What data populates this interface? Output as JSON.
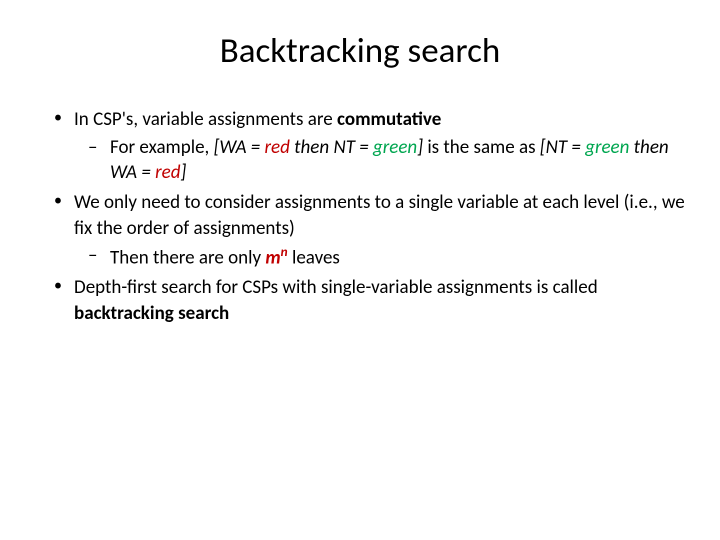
{
  "title": "Backtracking search",
  "b1_pre": "In CSP's, variable assignments are ",
  "b1_bold": "commutative",
  "b1a_pre": "For example, ",
  "b1a_i1": "[WA = ",
  "b1a_red1": "red",
  "b1a_i2": " then NT = ",
  "b1a_green1": "green",
  "b1a_i3": "]",
  "b1a_mid": " is the same as ",
  "b1a_i4": "[NT = ",
  "b1a_green2": "green",
  "b1a_i5": " then WA = ",
  "b1a_red2": "red",
  "b1a_i6": "]",
  "b2": "We only need to consider assignments to a single variable at each level (i.e., we fix the order of assignments)",
  "b2a_pre": " Then there are only ",
  "b2a_m": "m",
  "b2a_n": "n",
  "b2a_post": " leaves",
  "b3_pre": "Depth-first search for CSPs with single-variable assignments is called ",
  "b3_bold": "backtracking search"
}
